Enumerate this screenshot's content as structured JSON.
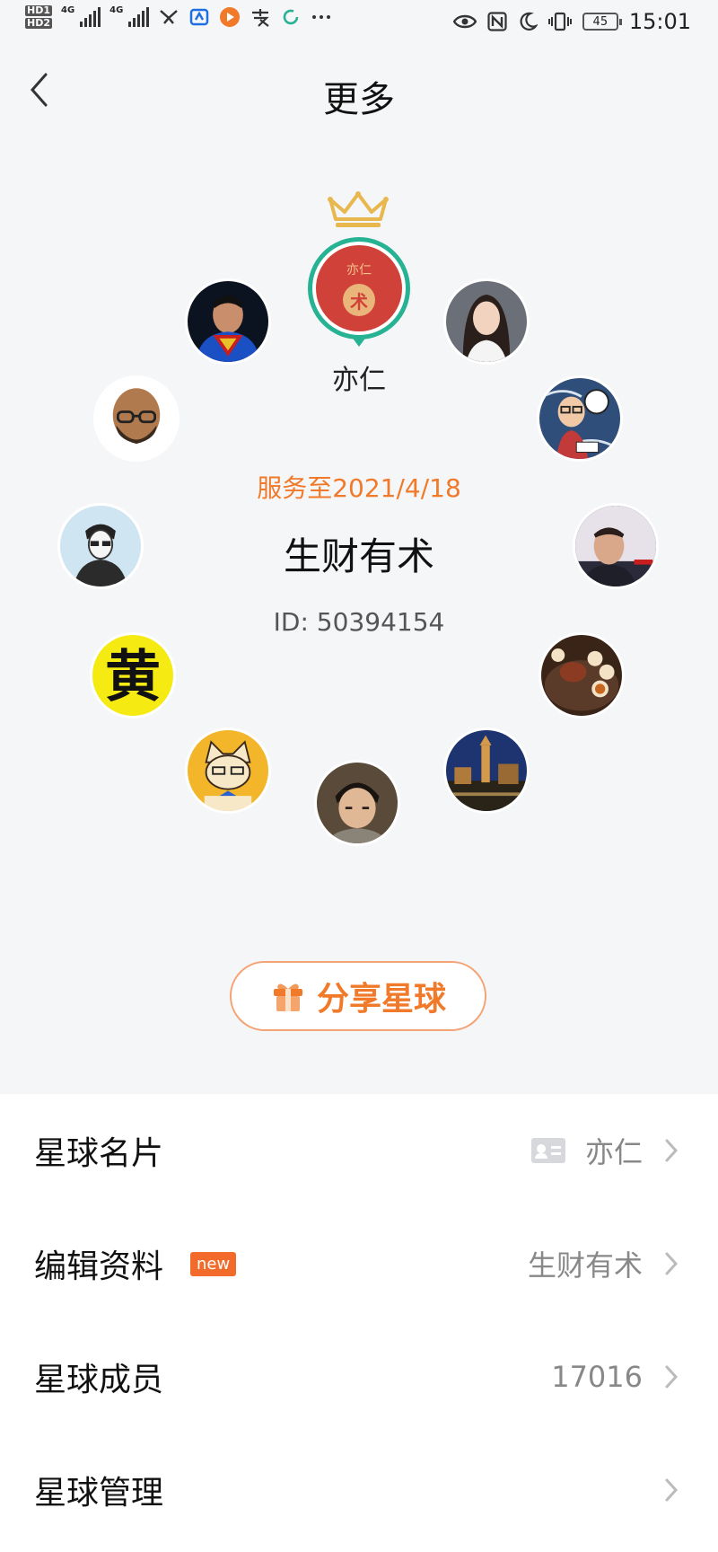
{
  "status_bar": {
    "hd1": "HD1",
    "hd2": "HD2",
    "net1": "4G",
    "net2": "4G",
    "battery": "45",
    "time": "15:01"
  },
  "nav": {
    "back_icon": "chevron-left-icon",
    "title": "更多"
  },
  "owner": {
    "name": "亦仁",
    "avatar_text": "亦仁",
    "avatar_seal": "术"
  },
  "members": [
    {
      "name": "superman-avatar"
    },
    {
      "name": "woman-portrait-avatar"
    },
    {
      "name": "bald-glasses-avatar"
    },
    {
      "name": "cartoon-glasses-avatar"
    },
    {
      "name": "sketch-portrait-avatar"
    },
    {
      "name": "man-portrait-avatar"
    },
    {
      "name": "huang-character-avatar",
      "text": "黄"
    },
    {
      "name": "tea-set-avatar"
    },
    {
      "name": "cartoon-cat-avatar"
    },
    {
      "name": "night-city-avatar"
    },
    {
      "name": "child-portrait-avatar"
    }
  ],
  "planet": {
    "service": "服务至2021/4/18",
    "name": "生财有术",
    "id": "ID: 50394154"
  },
  "share": {
    "label": "分享星球",
    "icon": "gift-icon"
  },
  "list": {
    "card_label": "星球名片",
    "card_value": "亦仁",
    "edit_label": "编辑资料",
    "edit_badge": "new",
    "edit_value": "生财有术",
    "members_label": "星球成员",
    "members_value": "17016",
    "manage_label": "星球管理"
  },
  "colors": {
    "accent": "#f07a2a",
    "ring": "#27b393",
    "owner_bg": "#d0413a"
  }
}
